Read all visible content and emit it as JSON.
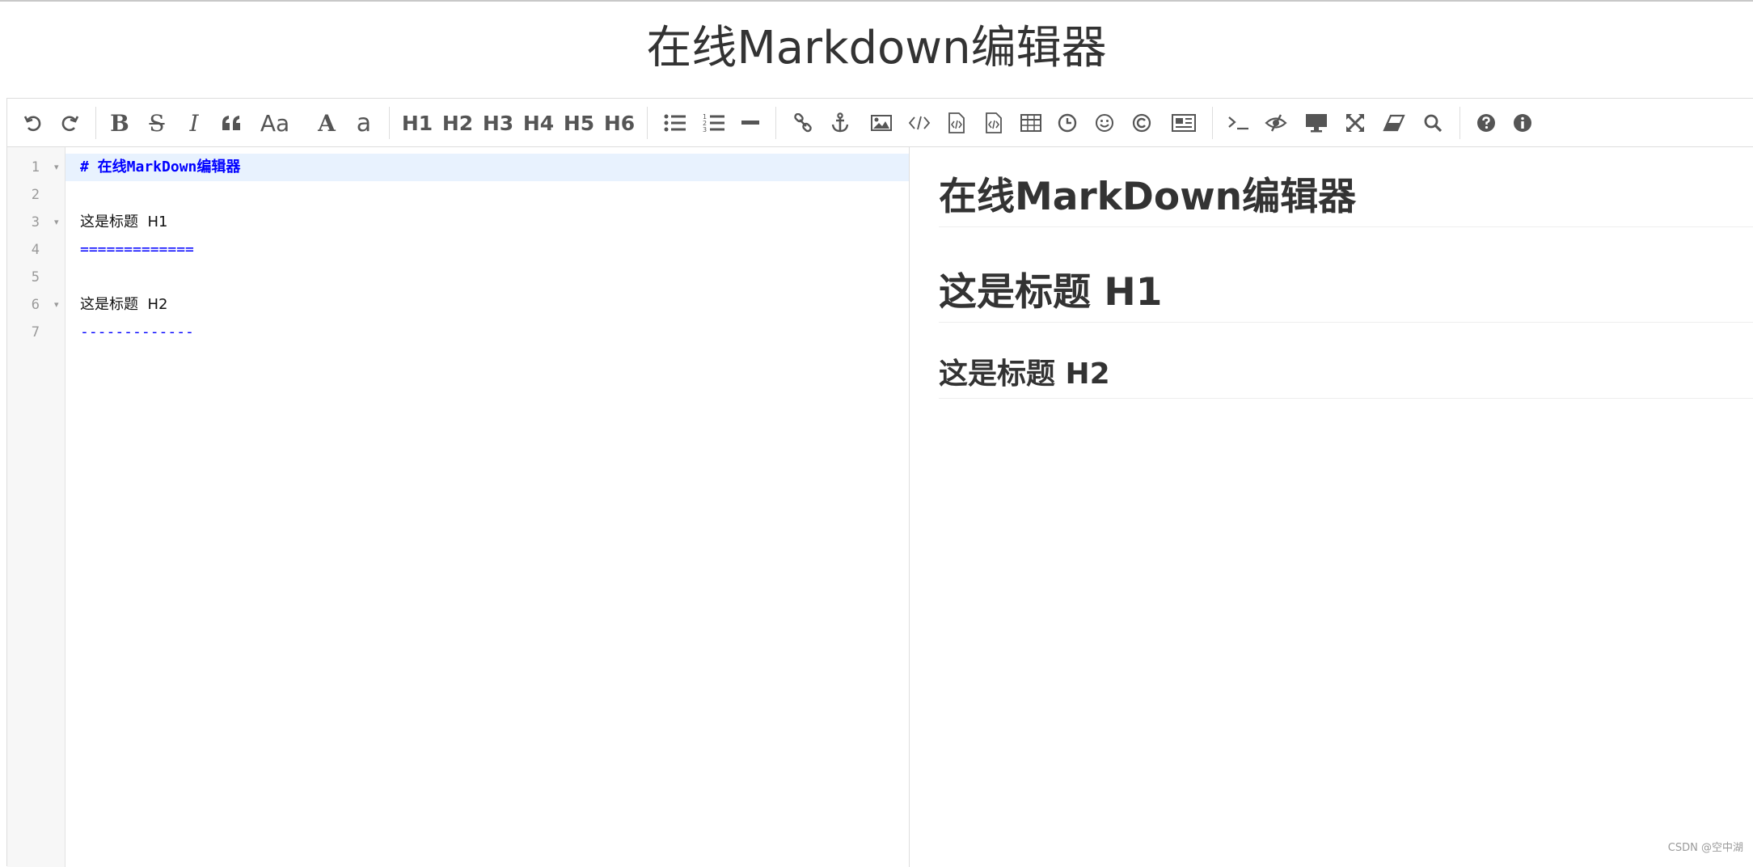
{
  "page": {
    "title": "在线Markdown编辑器"
  },
  "toolbar": {
    "headings": [
      "H1",
      "H2",
      "H3",
      "H4",
      "H5",
      "H6"
    ],
    "icons": [
      "undo-icon",
      "redo-icon",
      "bold-icon",
      "strikethrough-icon",
      "italic-icon",
      "quote-icon",
      "uppercase-icon",
      "uppercase-first-icon",
      "lowercase-icon",
      "unordered-list-icon",
      "ordered-list-icon",
      "horizontal-rule-icon",
      "link-icon",
      "anchor-icon",
      "image-icon",
      "inline-code-icon",
      "code-block-icon",
      "preformatted-text-icon",
      "table-icon",
      "datetime-icon",
      "emoji-icon",
      "html-entities-icon",
      "pagebreak-icon",
      "goto-line-icon",
      "watch-icon",
      "preview-icon",
      "fullscreen-icon",
      "clear-icon",
      "search-icon",
      "help-icon",
      "info-icon"
    ],
    "labels": {
      "uppercase": "Aa",
      "uppercase_first": "A",
      "lowercase": "a",
      "bold": "B",
      "strikethrough": "S",
      "italic": "I"
    }
  },
  "code": {
    "lines": [
      {
        "num": "1",
        "text": "# 在线MarkDown编辑器",
        "fold": "▾"
      },
      {
        "num": "2",
        "text": ""
      },
      {
        "num": "3",
        "text": "这是标题  H1",
        "fold": "▾"
      },
      {
        "num": "4",
        "text": "============="
      },
      {
        "num": "5",
        "text": ""
      },
      {
        "num": "6",
        "text": "这是标题  H2",
        "fold": "▾"
      },
      {
        "num": "7",
        "text": "-------------"
      }
    ]
  },
  "preview": {
    "h1_title": "在线MarkDown编辑器",
    "h1_second": "这是标题 H1",
    "h2": "这是标题 H2"
  },
  "watermark": "CSDN @空中湖"
}
